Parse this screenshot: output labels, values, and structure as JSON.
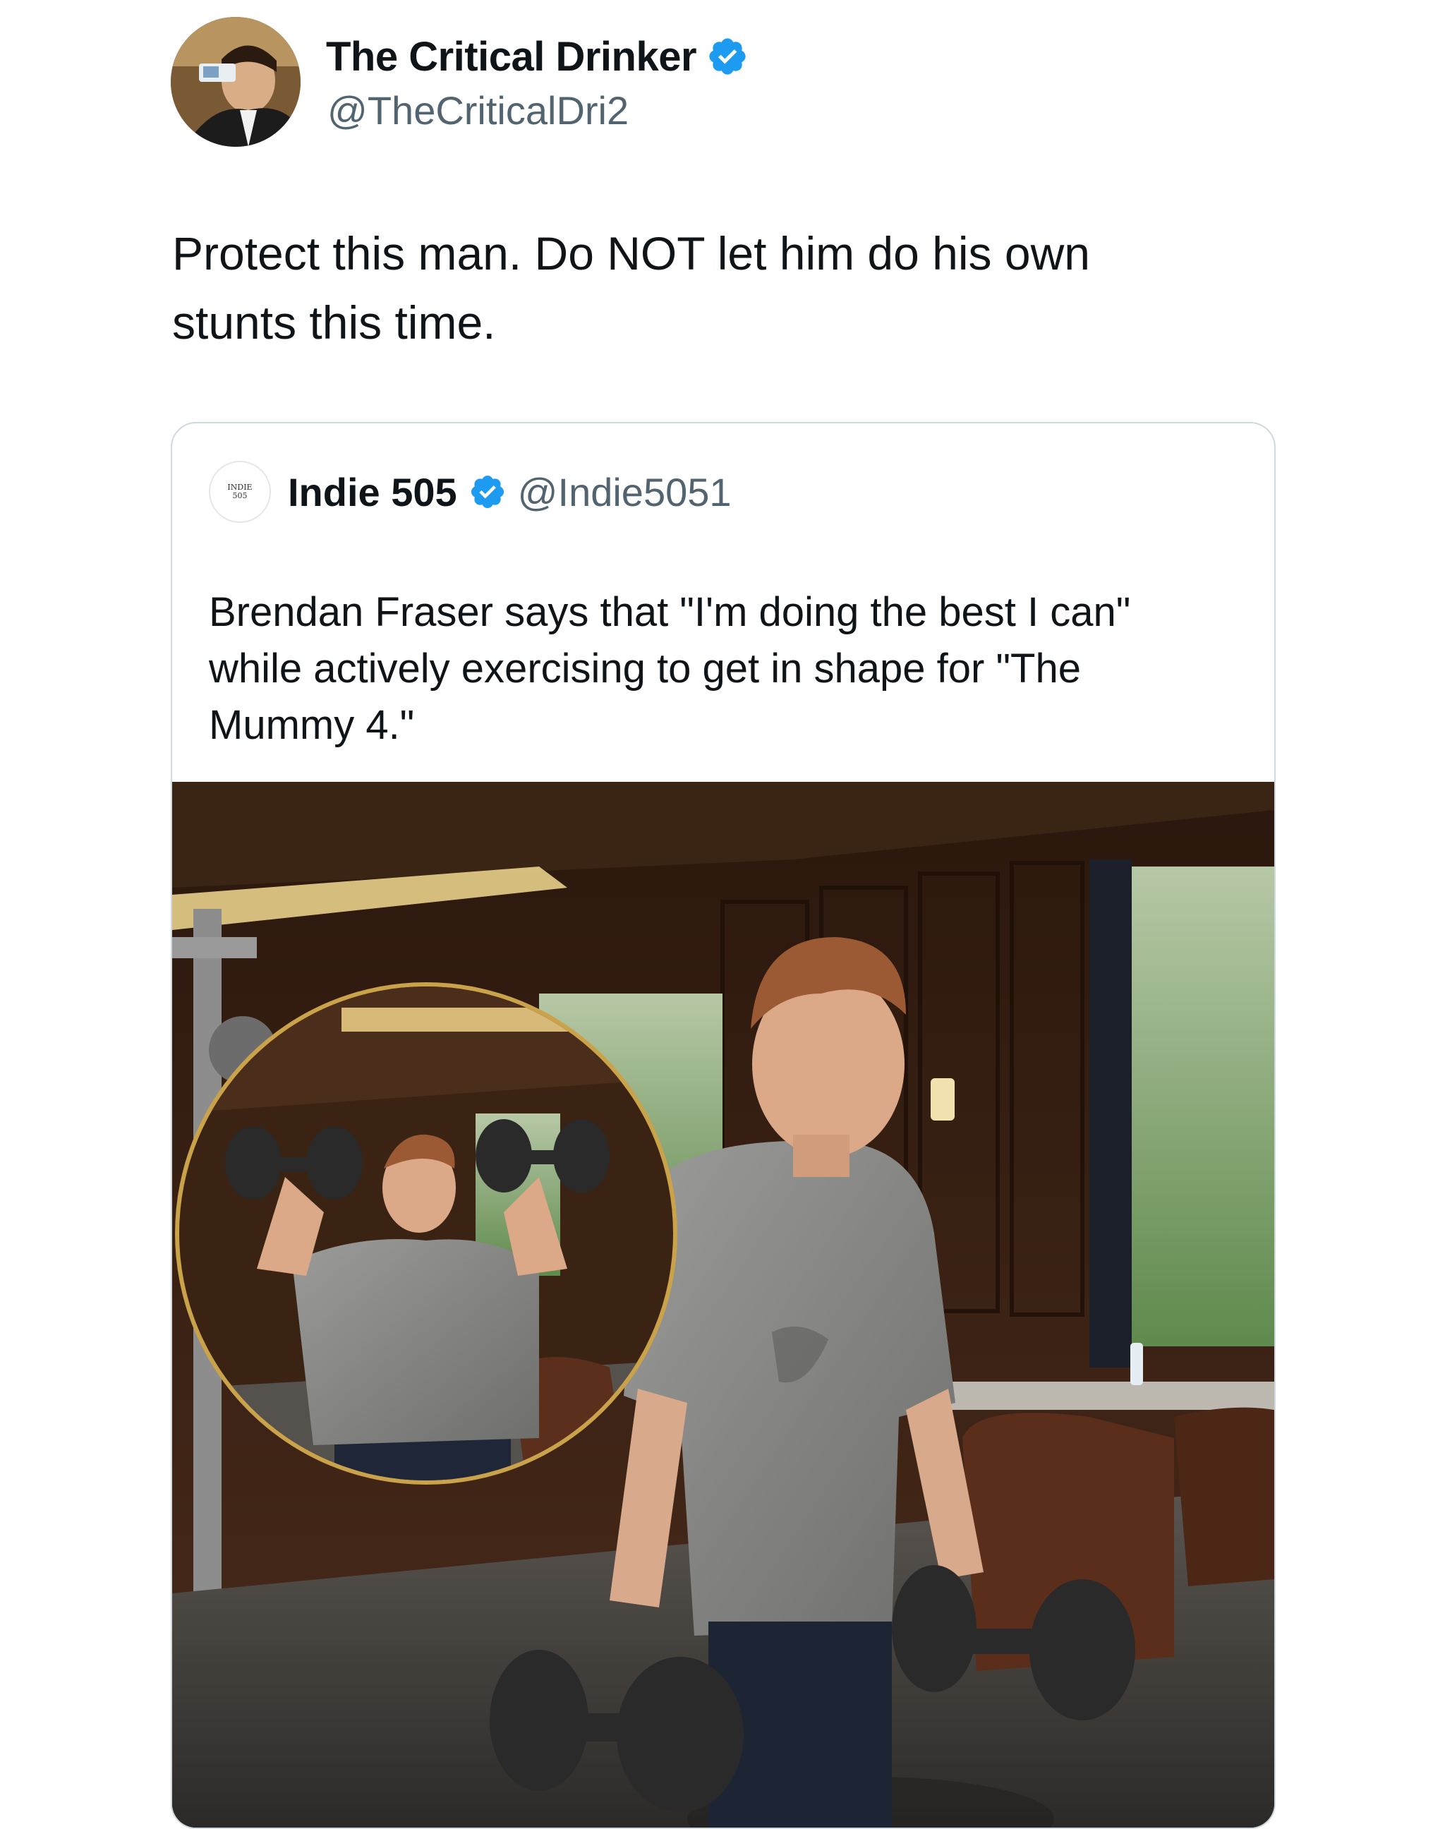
{
  "tweet": {
    "author": {
      "display_name": "The Critical Drinker",
      "handle": "@TheCriticalDri2",
      "verified_icon": "verified-badge-icon",
      "verified_color": "#1d9bf0"
    },
    "text_line_1": "Protect this man. Do NOT let him do his own",
    "text_line_2": "stunts this time."
  },
  "quoted_tweet": {
    "author": {
      "display_name": "Indie 505",
      "handle": "@Indie5051",
      "avatar_text_1": "INDIE",
      "avatar_text_2": "505",
      "verified_icon": "verified-badge-icon"
    },
    "text_line_1": "Brendan Fraser says that \"I'm doing the best I can\"",
    "text_line_2": "while actively exercising to get in shape for \"The",
    "text_line_3": "Mummy 4.\"",
    "media": {
      "kind": "photo",
      "inset": "circular inset with gold ring"
    }
  },
  "colors": {
    "text_primary": "#0f1419",
    "text_secondary": "#536471",
    "border": "#cfd9de",
    "inset_ring": "#c9a24a"
  }
}
